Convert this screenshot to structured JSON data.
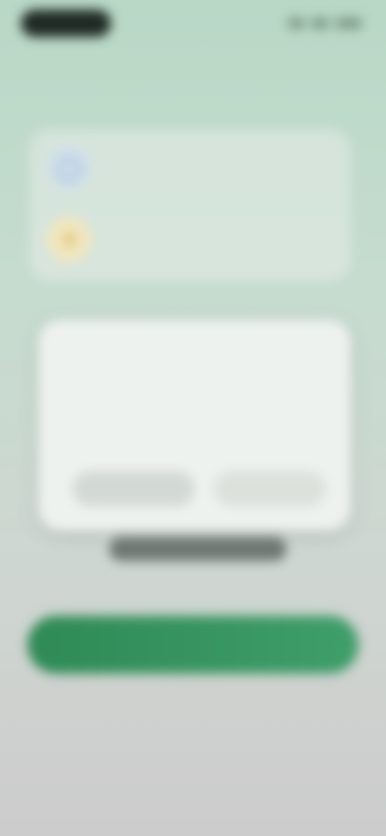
{
  "status_bar": {},
  "perks": [
    {
      "icon": "globe-icon",
      "title": "",
      "description": ""
    },
    {
      "icon": "sun-icon",
      "title": "",
      "description": ""
    }
  ],
  "dialog": {
    "title": "",
    "body": "",
    "body_highlight": "",
    "secondary_button": "",
    "primary_button": ""
  },
  "overlay_pill": "",
  "cta_button": "",
  "footer_link": "",
  "colors": {
    "accent": "#3a9563",
    "background_top": "#b9d8c6",
    "background_bottom": "#cccccc",
    "perk_blue": "#5b8fc7",
    "perk_gold": "#d1aa46"
  }
}
